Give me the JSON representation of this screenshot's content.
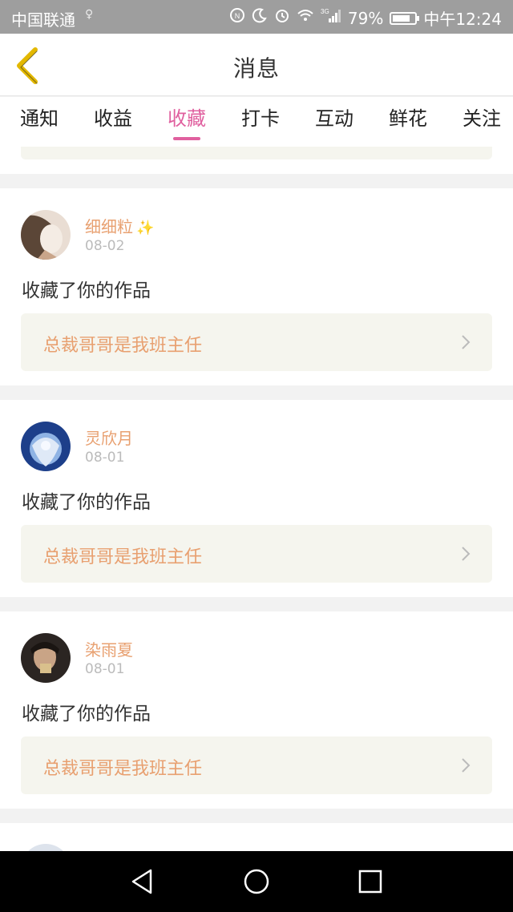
{
  "status_bar": {
    "carrier": "中国联通",
    "battery_percent_text": "79%",
    "battery_level": 0.79,
    "time": "中午12:24",
    "network_label": "3G",
    "icons": [
      "nfc-icon",
      "moon-icon",
      "alarm-icon",
      "wifi-icon",
      "signal-icon",
      "battery-icon"
    ]
  },
  "header": {
    "title": "消息",
    "back_icon": "back-chevron-icon",
    "back_color": "#e3b800"
  },
  "tabs": [
    {
      "label": "通知",
      "active": false
    },
    {
      "label": "收益",
      "active": false
    },
    {
      "label": "收藏",
      "active": true
    },
    {
      "label": "打卡",
      "active": false
    },
    {
      "label": "互动",
      "active": false
    },
    {
      "label": "鲜花",
      "active": false
    },
    {
      "label": "关注",
      "active": false
    }
  ],
  "messages": [
    {
      "username": "细细粒",
      "badge": "✨",
      "date": "08-02",
      "action": "收藏了你的作品",
      "work_title": "总裁哥哥是我班主任"
    },
    {
      "username": "灵欣月",
      "badge": "",
      "date": "08-01",
      "action": "收藏了你的作品",
      "work_title": "总裁哥哥是我班主任"
    },
    {
      "username": "染雨夏",
      "badge": "",
      "date": "08-01",
      "action": "收藏了你的作品",
      "work_title": "总裁哥哥是我班主任"
    }
  ],
  "colors": {
    "accent": "#e0609f",
    "username": "#e8a070",
    "work_bg": "#f5f5ee"
  },
  "nav": {
    "icons": [
      "nav-back-icon",
      "nav-home-icon",
      "nav-recents-icon"
    ]
  }
}
